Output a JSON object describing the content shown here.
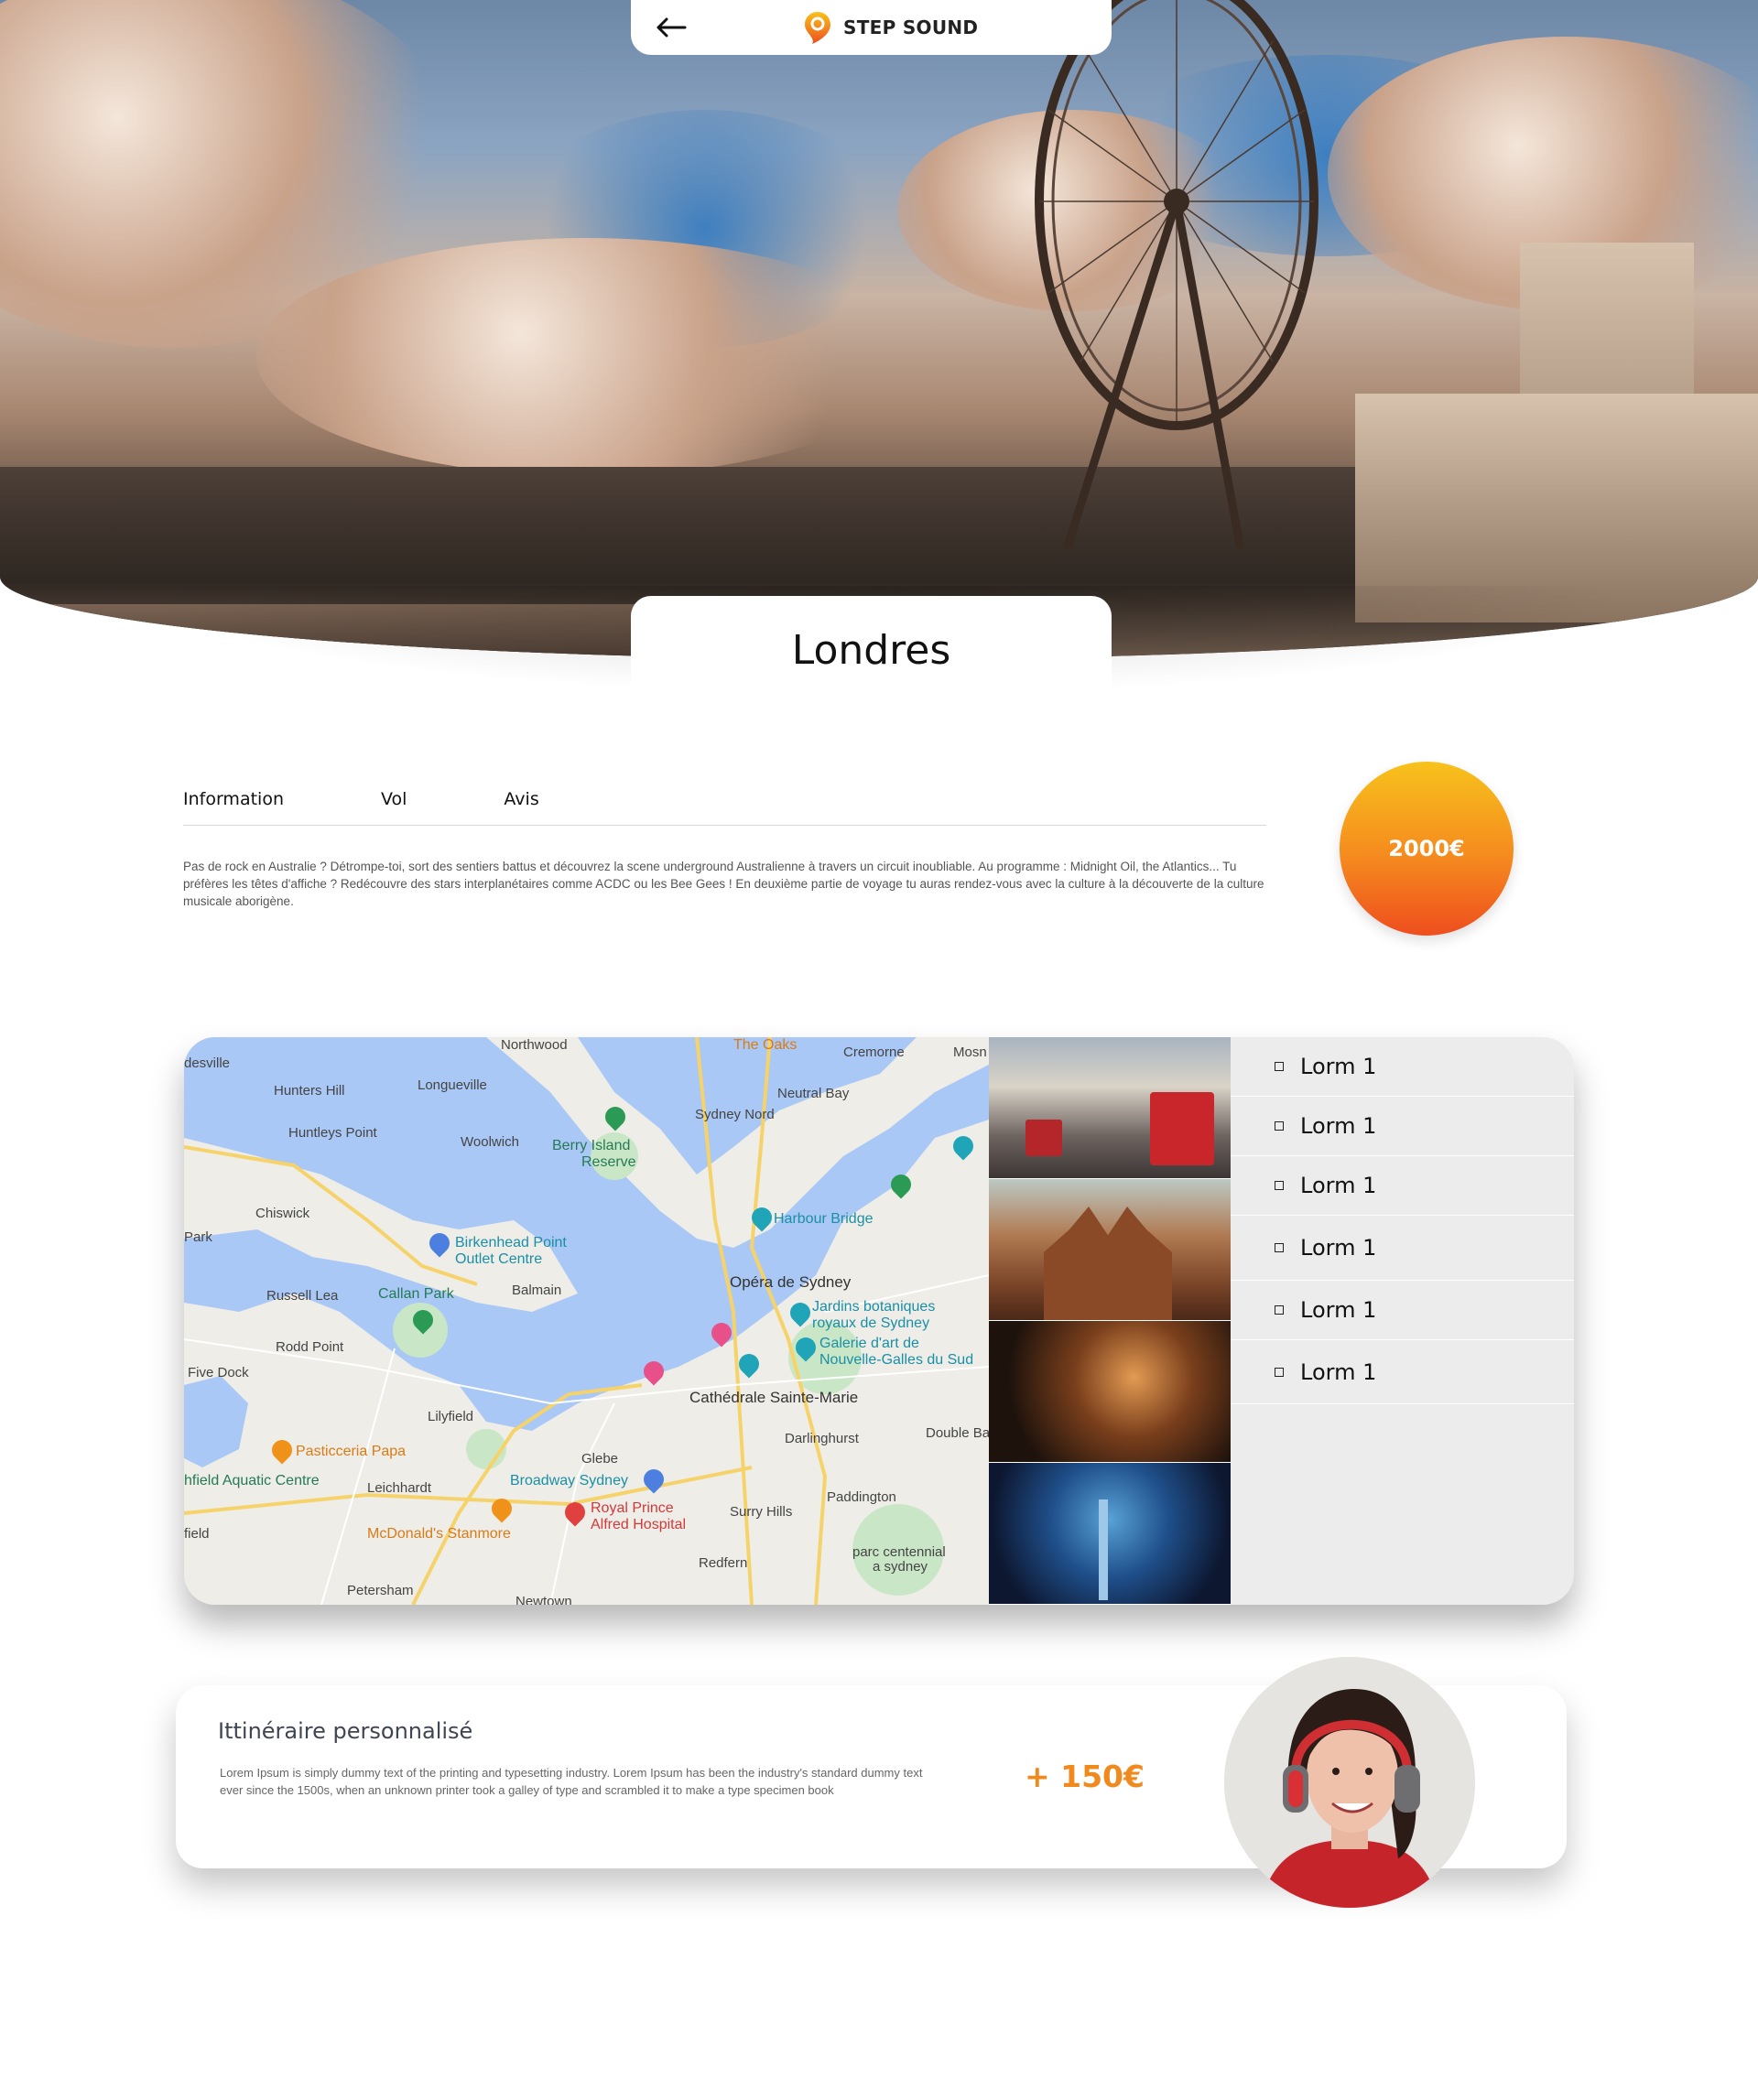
{
  "header": {
    "brand": "STEP SOUND"
  },
  "destination": {
    "title": "Londres"
  },
  "tabs": [
    {
      "label": "Information"
    },
    {
      "label": "Vol"
    },
    {
      "label": "Avis"
    }
  ],
  "description": "Pas de rock en Australie ? Détrompe-toi, sort des sentiers battus et découvrez la scene underground Australienne à travers un circuit inoubliable. Au programme : Midnight Oil, the Atlantics... Tu préfères les têtes d'affiche ? Redécouvre des stars interplanétaires comme ACDC ou les Bee Gees ! En deuxième partie de voyage tu auras rendez-vous avec la culture à la découverte de la culture musicale aborigène.",
  "price": "2000€",
  "map": {
    "labels": {
      "northwood": "Northwood",
      "the_oaks": "The Oaks",
      "cremorne": "Cremorne",
      "mosman": "Mosn",
      "desville": "desville",
      "hunters_hill": "Hunters Hill",
      "longueville": "Longueville",
      "neutral_bay": "Neutral Bay",
      "sydney_nord": "Sydney Nord",
      "huntleys_point": "Huntleys Point",
      "woolwich": "Woolwich",
      "berry_island": "Berry Island",
      "reserve": "Reserve",
      "chiswick": "Chiswick",
      "harbour_bridge": "Harbour Bridge",
      "park": "Park",
      "birkenhead": "Birkenhead Point",
      "outlet_centre": "Outlet Centre",
      "opera": "Opéra de Sydney",
      "russell_lea": "Russell Lea",
      "callan_park": "Callan Park",
      "balmain": "Balmain",
      "jardins_1": "Jardins botaniques",
      "jardins_2": "royaux de Sydney",
      "galerie_1": "Galerie d'art de",
      "galerie_2": "Nouvelle-Galles du Sud",
      "rodd_point": "Rodd Point",
      "five_dock": "Five Dock",
      "lilyfield": "Lilyfield",
      "cathedrale": "Cathédrale Sainte-Marie",
      "pasticceria": "Pasticceria Papa",
      "darlinghurst": "Darlinghurst",
      "double_bay": "Double Ba",
      "glebe": "Glebe",
      "aquatic": "hfield Aquatic Centre",
      "leichhardt": "Leichhardt",
      "broadway": "Broadway Sydney",
      "paddington": "Paddington",
      "royal_prince_1": "Royal Prince",
      "royal_prince_2": "Alfred Hospital",
      "surry_hills": "Surry Hills",
      "field": "field",
      "mcdonalds": "McDonald's Stanmore",
      "parc_1": "parc centennial",
      "parc_2": "a sydney",
      "redfern": "Redfern",
      "petersham": "Petersham",
      "newtown": "Newtown"
    }
  },
  "list_items": [
    {
      "label": "Lorm 1"
    },
    {
      "label": "Lorm 1"
    },
    {
      "label": "Lorm 1"
    },
    {
      "label": "Lorm 1"
    },
    {
      "label": "Lorm 1"
    },
    {
      "label": "Lorm 1"
    }
  ],
  "itinerary": {
    "title": "Ittinéraire personnalisé",
    "text": "Lorem Ipsum is simply dummy text of the printing and typesetting industry. Lorem Ipsum has been the industry's standard dummy text ever since the 1500s, when an unknown printer took a galley of type and scrambled it to make a type specimen book",
    "price": "+ 150€"
  },
  "colors": {
    "accent_orange": "#f08a1e",
    "price_gradient_top": "#f7c21c",
    "price_gradient_bottom": "#ee4e1e",
    "map_water": "#a9c8f5",
    "list_background": "#ececec"
  },
  "icons": {
    "back": "arrow-left-icon",
    "logo": "location-pin-logo"
  }
}
